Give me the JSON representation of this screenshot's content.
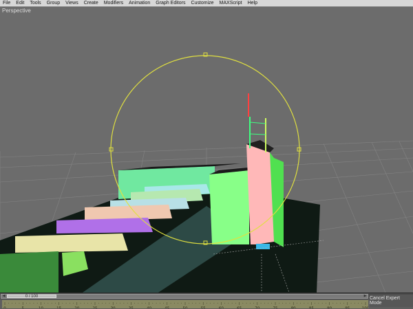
{
  "menu": {
    "items": [
      "File",
      "Edit",
      "Tools",
      "Group",
      "Views",
      "Create",
      "Modifiers",
      "Animation",
      "Graph Editors",
      "Customize",
      "MAXScript",
      "Help"
    ]
  },
  "viewport": {
    "label": "Perspective"
  },
  "timeline": {
    "frame_display": "0 / 100",
    "current_frame": 0,
    "total_frames": 100,
    "ruler_ticks": [
      "0",
      "5",
      "10",
      "15",
      "20",
      "25",
      "30",
      "35",
      "40",
      "45",
      "50",
      "55",
      "60",
      "65",
      "70",
      "75",
      "80",
      "85",
      "90",
      "95",
      "100"
    ]
  },
  "status": {
    "expert_button": "Cancel Expert Mode"
  },
  "colors": {
    "selection_gizmo": "#e0e040",
    "menubar": "#d7d7d7",
    "viewport_bg": "#6c6c6c"
  }
}
